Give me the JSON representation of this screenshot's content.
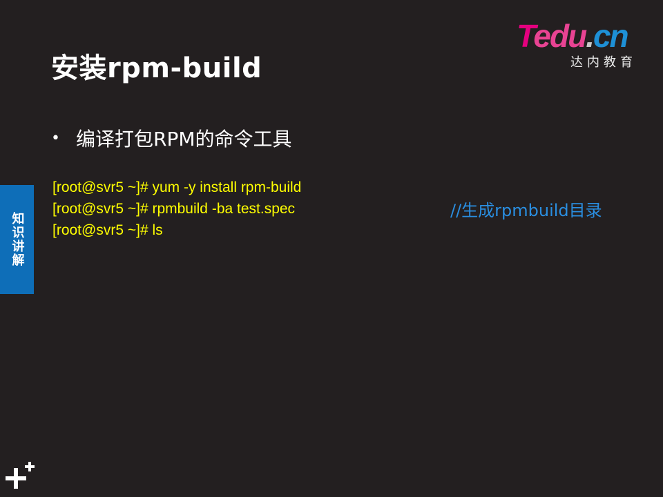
{
  "slide": {
    "title": "安装rpm-build",
    "logo": {
      "t": "T",
      "edu": "edu",
      "dot": ".",
      "cn": "cn",
      "subtitle": "达内教育"
    },
    "side_tab": {
      "label": "知识讲解"
    },
    "bullet": {
      "symbol": "•",
      "text": "编译打包RPM的命令工具"
    },
    "commands": [
      "[root@svr5 ~]# yum -y install rpm-build",
      "[root@svr5 ~]# rpmbuild -ba test.spec",
      "[root@svr5 ~]# ls"
    ],
    "comment": "//生成rpmbuild目录",
    "colors": {
      "background": "#231f20",
      "command_text": "#ffff00",
      "comment_text": "#2a8ee0",
      "side_tab_bg": "#0e6eb8"
    },
    "icons": {
      "corner": "plus-icon"
    }
  }
}
